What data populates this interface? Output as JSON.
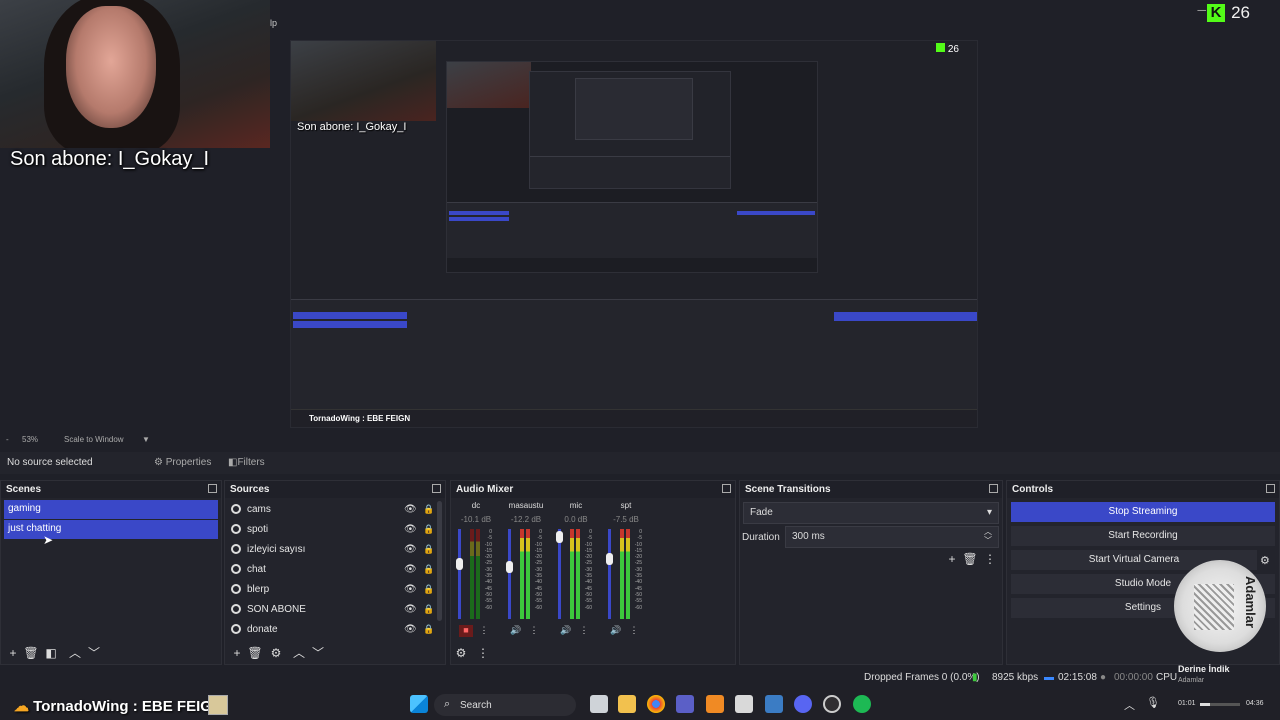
{
  "overlay": {
    "son_abone": "Son abone: I_Gokay_I",
    "menu_help": "lp",
    "kick_count": "26",
    "kick_logo": "K"
  },
  "preview": {
    "son_abone": "Son abone: I_Gokay_I",
    "kick_count": "26",
    "mini_ticker": "TornadoWing : EBE FEIGN"
  },
  "scale_bar": {
    "zoom": "53%",
    "mode": "Scale to Window"
  },
  "props_bar": {
    "no_source": "No source selected",
    "properties": "Properties",
    "filters": "Filters"
  },
  "scenes": {
    "title": "Scenes",
    "items": [
      "gaming",
      "just chatting"
    ]
  },
  "sources": {
    "title": "Sources",
    "items": [
      "cams",
      "spoti",
      "izleyici sayısı",
      "chat",
      "blerp",
      "SON ABONE",
      "donate"
    ]
  },
  "mixer": {
    "title": "Audio Mixer",
    "channels": [
      {
        "name": "dc",
        "db": "-10.1 dB"
      },
      {
        "name": "masaustu",
        "db": "-12.2 dB"
      },
      {
        "name": "mic",
        "db": "0.0 dB"
      },
      {
        "name": "spt",
        "db": "-7.5 dB"
      }
    ],
    "scale_labels": [
      "0",
      "-5",
      "-10",
      "-15",
      "-20",
      "-25",
      "-30",
      "-35",
      "-40",
      "-45",
      "-50",
      "-55",
      "-60"
    ]
  },
  "transitions": {
    "title": "Scene Transitions",
    "type": "Fade",
    "duration_label": "Duration",
    "duration_value": "300 ms"
  },
  "controls": {
    "title": "Controls",
    "buttons": [
      "Stop Streaming",
      "Start Recording",
      "Start Virtual Camera",
      "Studio Mode",
      "Settings"
    ]
  },
  "status": {
    "dropped": "Dropped Frames 0 (0.0%)",
    "kbps": "8925 kbps",
    "live_time": "02:15:08",
    "rec_time": "00:00:00",
    "cpu": "CPU"
  },
  "spotify": {
    "track": "Derine İndik",
    "artist": "Adamlar",
    "time": "01:01",
    "time_end": "04:36"
  },
  "taskbar": {
    "ticker": "TornadoWing : EBE FEIGN",
    "search": "Search"
  },
  "colors": {
    "accent": "#3a48c8",
    "panel": "#23242c",
    "bg": "#1f2028",
    "kick": "#53fc18"
  }
}
